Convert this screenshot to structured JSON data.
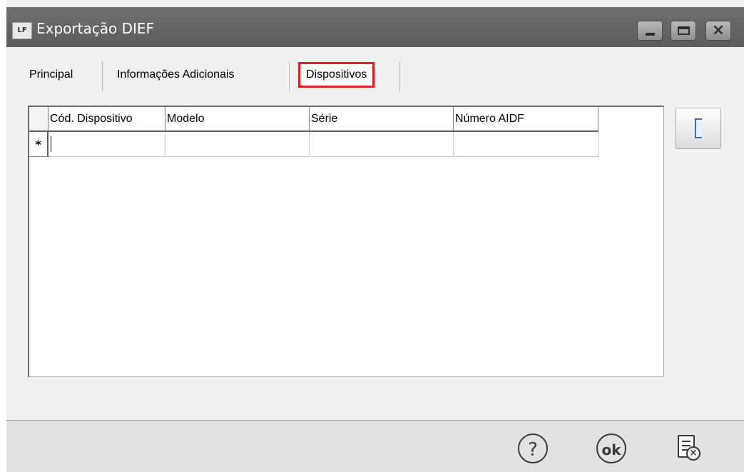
{
  "window": {
    "title": "Exportação DIEF",
    "app_icon_text": "LF",
    "controls": {
      "minimize": "minimize-icon",
      "maximize": "maximize-icon",
      "close": "close-icon"
    }
  },
  "tabs": [
    {
      "label": "Principal",
      "active": false
    },
    {
      "label": "Informações Adicionais",
      "active": false
    },
    {
      "label": "Dispositivos",
      "active": true
    }
  ],
  "grid": {
    "columns": [
      "Cód. Dispositivo",
      "Modelo",
      "Série",
      "Número AIDF"
    ],
    "new_row_marker": "*",
    "rows": []
  },
  "side_button": {
    "icon": "bracket-icon"
  },
  "footer": {
    "help_label": "?",
    "ok_label": "ok",
    "cancel_icon": "document-cancel-icon"
  },
  "colors": {
    "titlebar": "#636363",
    "highlight": "#e02020",
    "panel_bg": "#f0f0f0"
  }
}
